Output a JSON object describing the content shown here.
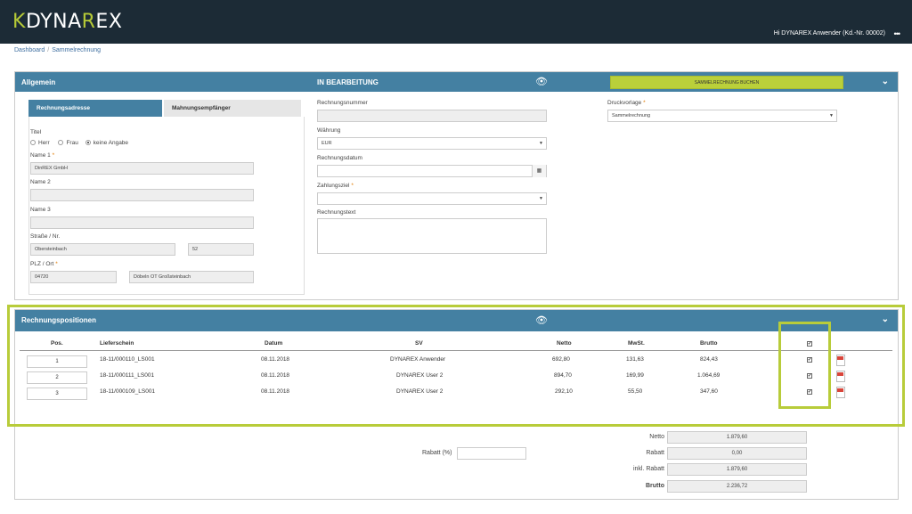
{
  "header": {
    "logo_k": "K",
    "logo_dyna": "DYNA",
    "logo_r": "R",
    "logo_ex": "EX",
    "user": "Hi DYNAREX Anwender (Kd.-Nr. 00002)",
    "menu_dots": "•••"
  },
  "breadcrumb": {
    "home": "Dashboard",
    "sep": "/",
    "current": "Sammelrechnung"
  },
  "allgemein": {
    "title": "Allgemein",
    "status": "IN BEARBEITUNG",
    "book_button": "SAMMELRECHNUNG BUCHEN",
    "tabs": {
      "address": "Rechnungsadresse",
      "dunning": "Mahnungsempfänger"
    },
    "titel_label": "Titel",
    "titel_options": [
      "Herr",
      "Frau",
      "keine Angabe"
    ],
    "name1_label": "Name 1",
    "name1_value": "DinREX GmbH",
    "name2_label": "Name 2",
    "name3_label": "Name 3",
    "strasse_label": "Straße / Nr.",
    "strasse_value": "Obersteinbach",
    "nr_value": "52",
    "plz_label": "PLZ / Ort",
    "plz_value": "04720",
    "ort_value": "Döbeln OT Großsteinbach",
    "rechnungsnummer_label": "Rechnungsnummer",
    "waehrung_label": "Währung",
    "waehrung_value": "EUR",
    "rechnungsdatum_label": "Rechnungsdatum",
    "zahlungsziel_label": "Zahlungsziel",
    "rechnungstext_label": "Rechnungstext",
    "druckvorlage_label": "Druckvorlage",
    "druckvorlage_value": "Sammelrechnung",
    "required": "*",
    "calendar_icon": "▦",
    "select_arrow": "▼"
  },
  "positions": {
    "title": "Rechnungspositionen",
    "columns": [
      "Pos.",
      "Lieferschein",
      "Datum",
      "SV",
      "Netto",
      "MwSt.",
      "Brutto"
    ],
    "rows": [
      {
        "pos": "1",
        "lieferschein": "18-11/000110_LS001",
        "datum": "08.11.2018",
        "sv": "DYNAREX Anwender",
        "netto": "692,80",
        "mwst": "131,63",
        "brutto": "824,43"
      },
      {
        "pos": "2",
        "lieferschein": "18-11/000111_LS001",
        "datum": "08.11.2018",
        "sv": "DYNAREX User 2",
        "netto": "894,70",
        "mwst": "169,99",
        "brutto": "1.064,69"
      },
      {
        "pos": "3",
        "lieferschein": "18-11/000109_LS001",
        "datum": "08.11.2018",
        "sv": "DYNAREX User 2",
        "netto": "292,10",
        "mwst": "55,50",
        "brutto": "347,60"
      }
    ],
    "check": "✔"
  },
  "totals": {
    "netto_label": "Netto",
    "netto_value": "1.879,60",
    "rabatt_label": "Rabatt",
    "rabatt_value": "0,00",
    "inkl_label": "inkl. Rabatt",
    "inkl_value": "1.879,60",
    "brutto_label": "Brutto",
    "brutto_value": "2.236,72",
    "rabatt_pct_label": "Rabatt (%)"
  },
  "icons": {
    "eye": "👁",
    "chevron": "⌄"
  },
  "colors": {
    "header_bg": "#1c2b36",
    "panel_head": "#4480a2",
    "accent_green": "#bad03a"
  }
}
